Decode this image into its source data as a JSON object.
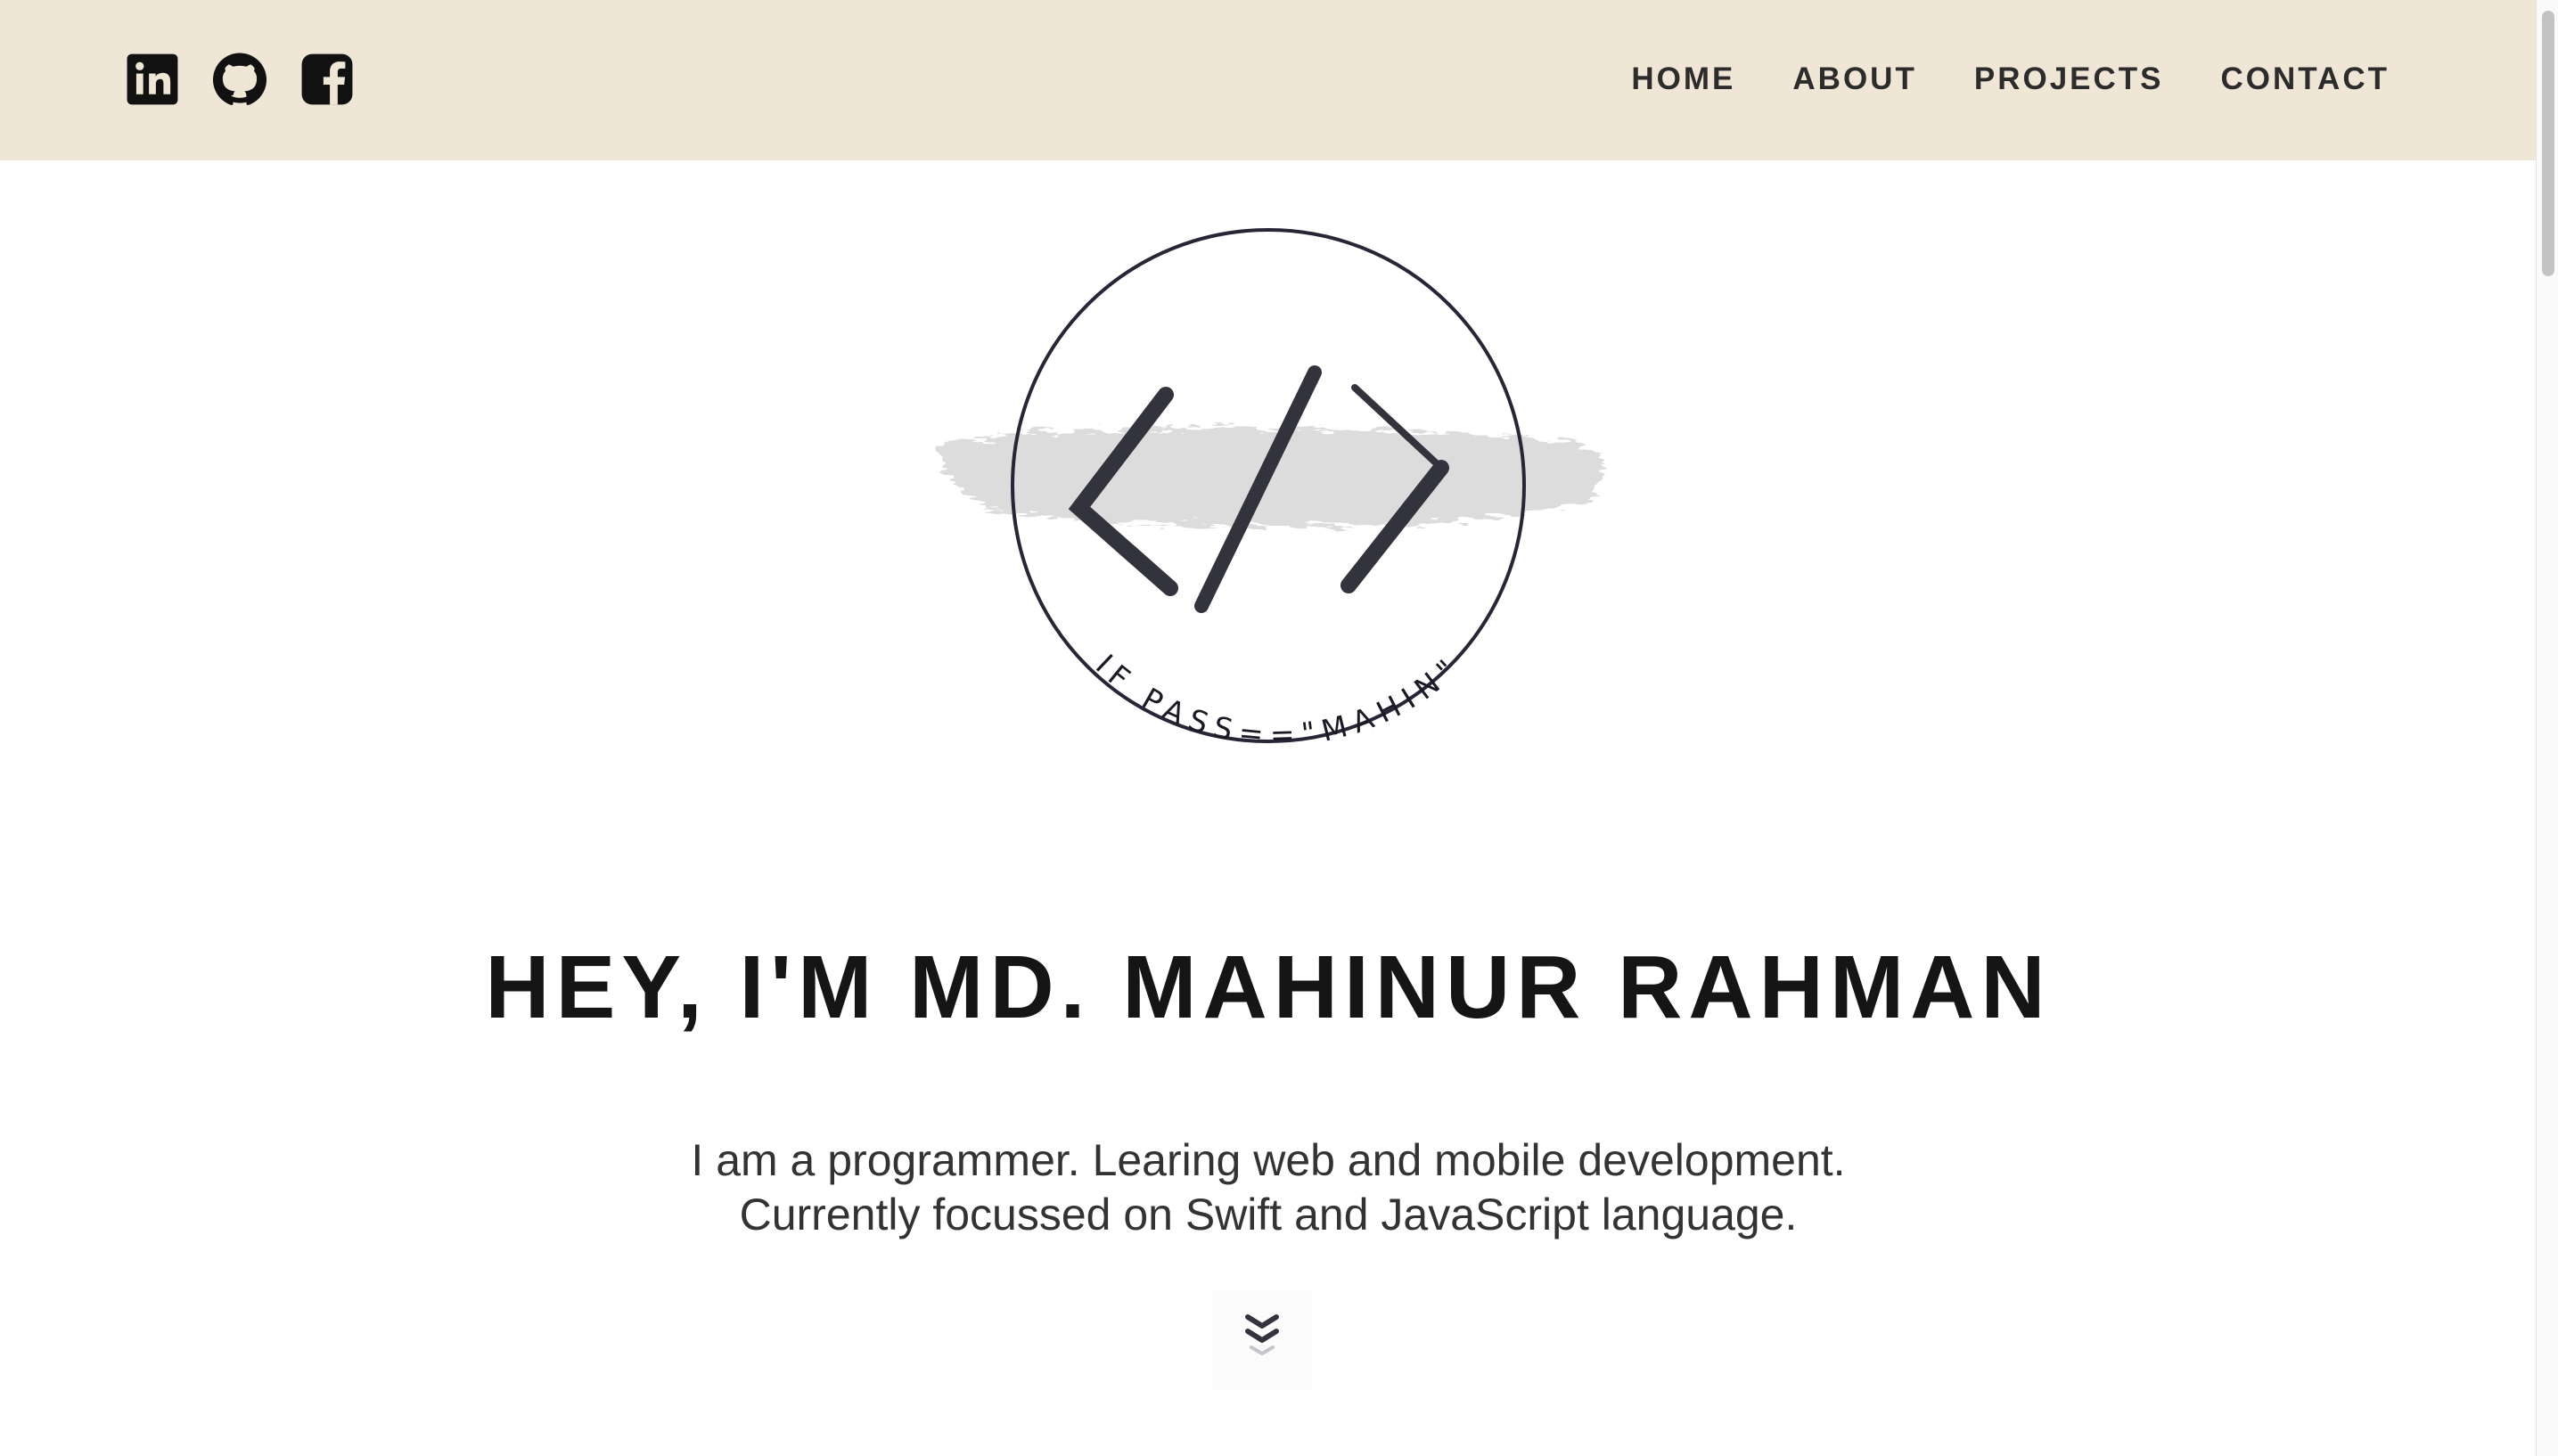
{
  "header": {
    "social": [
      {
        "name": "linkedin-icon"
      },
      {
        "name": "github-icon"
      },
      {
        "name": "facebook-icon"
      }
    ],
    "nav": [
      "HOME",
      "ABOUT",
      "PROJECTS",
      "CONTACT"
    ]
  },
  "logo": {
    "arc_text": "IF PASS==\"MAHIN\""
  },
  "hero": {
    "title": "HEY, I'M MD. MAHINUR RAHMAN",
    "desc_line1": "I am a programmer. Learing web and mobile development.",
    "desc_line2": "Currently focussed on Swift and JavaScript language."
  },
  "scroll_down": {
    "icon": "double-chevron-down-icon"
  },
  "colors": {
    "header_bg": "#efe6d6",
    "text_dark": "#151515",
    "logo_dark": "#33333d",
    "brush_gray": "#dcdcdc"
  }
}
